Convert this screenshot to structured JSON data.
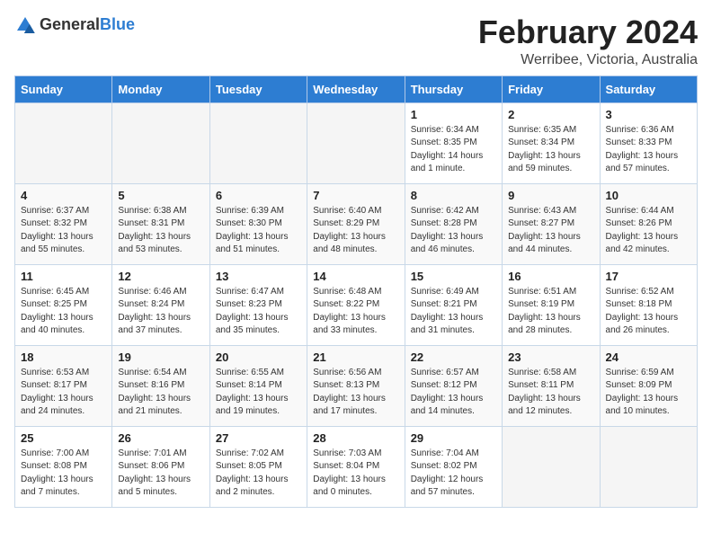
{
  "header": {
    "logo_general": "General",
    "logo_blue": "Blue",
    "month_year": "February 2024",
    "location": "Werribee, Victoria, Australia"
  },
  "days_of_week": [
    "Sunday",
    "Monday",
    "Tuesday",
    "Wednesday",
    "Thursday",
    "Friday",
    "Saturday"
  ],
  "weeks": [
    [
      {
        "day": "",
        "info": ""
      },
      {
        "day": "",
        "info": ""
      },
      {
        "day": "",
        "info": ""
      },
      {
        "day": "",
        "info": ""
      },
      {
        "day": "1",
        "info": "Sunrise: 6:34 AM\nSunset: 8:35 PM\nDaylight: 14 hours\nand 1 minute."
      },
      {
        "day": "2",
        "info": "Sunrise: 6:35 AM\nSunset: 8:34 PM\nDaylight: 13 hours\nand 59 minutes."
      },
      {
        "day": "3",
        "info": "Sunrise: 6:36 AM\nSunset: 8:33 PM\nDaylight: 13 hours\nand 57 minutes."
      }
    ],
    [
      {
        "day": "4",
        "info": "Sunrise: 6:37 AM\nSunset: 8:32 PM\nDaylight: 13 hours\nand 55 minutes."
      },
      {
        "day": "5",
        "info": "Sunrise: 6:38 AM\nSunset: 8:31 PM\nDaylight: 13 hours\nand 53 minutes."
      },
      {
        "day": "6",
        "info": "Sunrise: 6:39 AM\nSunset: 8:30 PM\nDaylight: 13 hours\nand 51 minutes."
      },
      {
        "day": "7",
        "info": "Sunrise: 6:40 AM\nSunset: 8:29 PM\nDaylight: 13 hours\nand 48 minutes."
      },
      {
        "day": "8",
        "info": "Sunrise: 6:42 AM\nSunset: 8:28 PM\nDaylight: 13 hours\nand 46 minutes."
      },
      {
        "day": "9",
        "info": "Sunrise: 6:43 AM\nSunset: 8:27 PM\nDaylight: 13 hours\nand 44 minutes."
      },
      {
        "day": "10",
        "info": "Sunrise: 6:44 AM\nSunset: 8:26 PM\nDaylight: 13 hours\nand 42 minutes."
      }
    ],
    [
      {
        "day": "11",
        "info": "Sunrise: 6:45 AM\nSunset: 8:25 PM\nDaylight: 13 hours\nand 40 minutes."
      },
      {
        "day": "12",
        "info": "Sunrise: 6:46 AM\nSunset: 8:24 PM\nDaylight: 13 hours\nand 37 minutes."
      },
      {
        "day": "13",
        "info": "Sunrise: 6:47 AM\nSunset: 8:23 PM\nDaylight: 13 hours\nand 35 minutes."
      },
      {
        "day": "14",
        "info": "Sunrise: 6:48 AM\nSunset: 8:22 PM\nDaylight: 13 hours\nand 33 minutes."
      },
      {
        "day": "15",
        "info": "Sunrise: 6:49 AM\nSunset: 8:21 PM\nDaylight: 13 hours\nand 31 minutes."
      },
      {
        "day": "16",
        "info": "Sunrise: 6:51 AM\nSunset: 8:19 PM\nDaylight: 13 hours\nand 28 minutes."
      },
      {
        "day": "17",
        "info": "Sunrise: 6:52 AM\nSunset: 8:18 PM\nDaylight: 13 hours\nand 26 minutes."
      }
    ],
    [
      {
        "day": "18",
        "info": "Sunrise: 6:53 AM\nSunset: 8:17 PM\nDaylight: 13 hours\nand 24 minutes."
      },
      {
        "day": "19",
        "info": "Sunrise: 6:54 AM\nSunset: 8:16 PM\nDaylight: 13 hours\nand 21 minutes."
      },
      {
        "day": "20",
        "info": "Sunrise: 6:55 AM\nSunset: 8:14 PM\nDaylight: 13 hours\nand 19 minutes."
      },
      {
        "day": "21",
        "info": "Sunrise: 6:56 AM\nSunset: 8:13 PM\nDaylight: 13 hours\nand 17 minutes."
      },
      {
        "day": "22",
        "info": "Sunrise: 6:57 AM\nSunset: 8:12 PM\nDaylight: 13 hours\nand 14 minutes."
      },
      {
        "day": "23",
        "info": "Sunrise: 6:58 AM\nSunset: 8:11 PM\nDaylight: 13 hours\nand 12 minutes."
      },
      {
        "day": "24",
        "info": "Sunrise: 6:59 AM\nSunset: 8:09 PM\nDaylight: 13 hours\nand 10 minutes."
      }
    ],
    [
      {
        "day": "25",
        "info": "Sunrise: 7:00 AM\nSunset: 8:08 PM\nDaylight: 13 hours\nand 7 minutes."
      },
      {
        "day": "26",
        "info": "Sunrise: 7:01 AM\nSunset: 8:06 PM\nDaylight: 13 hours\nand 5 minutes."
      },
      {
        "day": "27",
        "info": "Sunrise: 7:02 AM\nSunset: 8:05 PM\nDaylight: 13 hours\nand 2 minutes."
      },
      {
        "day": "28",
        "info": "Sunrise: 7:03 AM\nSunset: 8:04 PM\nDaylight: 13 hours\nand 0 minutes."
      },
      {
        "day": "29",
        "info": "Sunrise: 7:04 AM\nSunset: 8:02 PM\nDaylight: 12 hours\nand 57 minutes."
      },
      {
        "day": "",
        "info": ""
      },
      {
        "day": "",
        "info": ""
      }
    ]
  ]
}
